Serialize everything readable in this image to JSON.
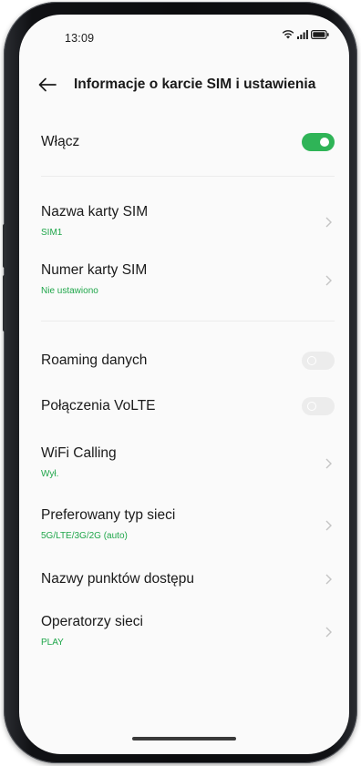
{
  "status_bar": {
    "time": "13:09",
    "icons": [
      "wifi-icon",
      "signal-icon",
      "battery-icon"
    ]
  },
  "header": {
    "back_icon": "back-arrow-icon",
    "title": "Informacje o karcie SIM i ustawienia"
  },
  "settings": {
    "enable": {
      "label": "Włącz",
      "toggle": "on"
    },
    "sim_name": {
      "label": "Nazwa karty SIM",
      "value": "SIM1"
    },
    "sim_number": {
      "label": "Numer karty SIM",
      "value": "Nie ustawiono"
    },
    "roaming": {
      "label": "Roaming danych",
      "toggle": "off"
    },
    "volte": {
      "label": "Połączenia VoLTE",
      "toggle": "off"
    },
    "wifi_calling": {
      "label": "WiFi Calling",
      "value": "Wył."
    },
    "network_type": {
      "label": "Preferowany typ sieci",
      "value": "5G/LTE/3G/2G (auto)"
    },
    "apn": {
      "label": "Nazwy punktów dostępu"
    },
    "operators": {
      "label": "Operatorzy sieci",
      "value": "PLAY"
    }
  },
  "colors": {
    "accent": "#2fb457",
    "subtext": "#1fa64a",
    "toggle_off": "#ececec",
    "background": "#fafafa"
  }
}
